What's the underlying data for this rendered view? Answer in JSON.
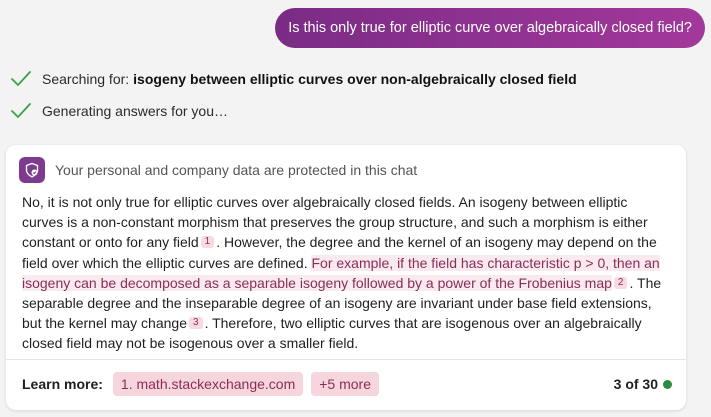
{
  "user_message": "Is this only true for elliptic curve over algebraically closed field?",
  "status": {
    "searching_prefix": "Searching for:",
    "searching_query": "isogeny between elliptic curves over non-algebraically closed field",
    "generating": "Generating answers for you…"
  },
  "card": {
    "privacy_notice": "Your personal and company data are protected in this chat",
    "answer": {
      "t1": "No, it is not only true for elliptic curves over algebraically closed fields. An isogeny between elliptic curves is a non-constant morphism that preserves the group structure, and such a morphism is either constant or onto for any field",
      "c1": "1",
      "t2": ". However, the degree and the kernel of an isogeny may depend on the field over which the elliptic curves are defined.",
      "t3_highlight": "For example, if the field has characteristic p > 0, then an isogeny can be decomposed as a separable isogeny followed by a power of the Frobenius map",
      "c2": "2",
      "t4": ". The separable degree and the inseparable degree of an isogeny are invariant under base field extensions, but the kernel may change",
      "c3": "3",
      "t5": ". Therefore, two elliptic curves that are isogenous over an algebraically closed field may not be isogenous over a smaller field."
    },
    "footer": {
      "learn_more": "Learn more:",
      "source1": "1. math.stackexchange.com",
      "more": "+5 more",
      "count": "3 of 30"
    }
  },
  "colors": {
    "accent": "#7d3a8e",
    "bubble_start": "#7a2c85",
    "bubble_end": "#a3389a",
    "chip_bg": "#f6d6dc",
    "citation_text": "#8a2d55",
    "check_green": "#3aa04a",
    "status_dot": "#2d8a3e"
  },
  "icons": [
    "check-icon",
    "check-icon",
    "shield-icon"
  ]
}
